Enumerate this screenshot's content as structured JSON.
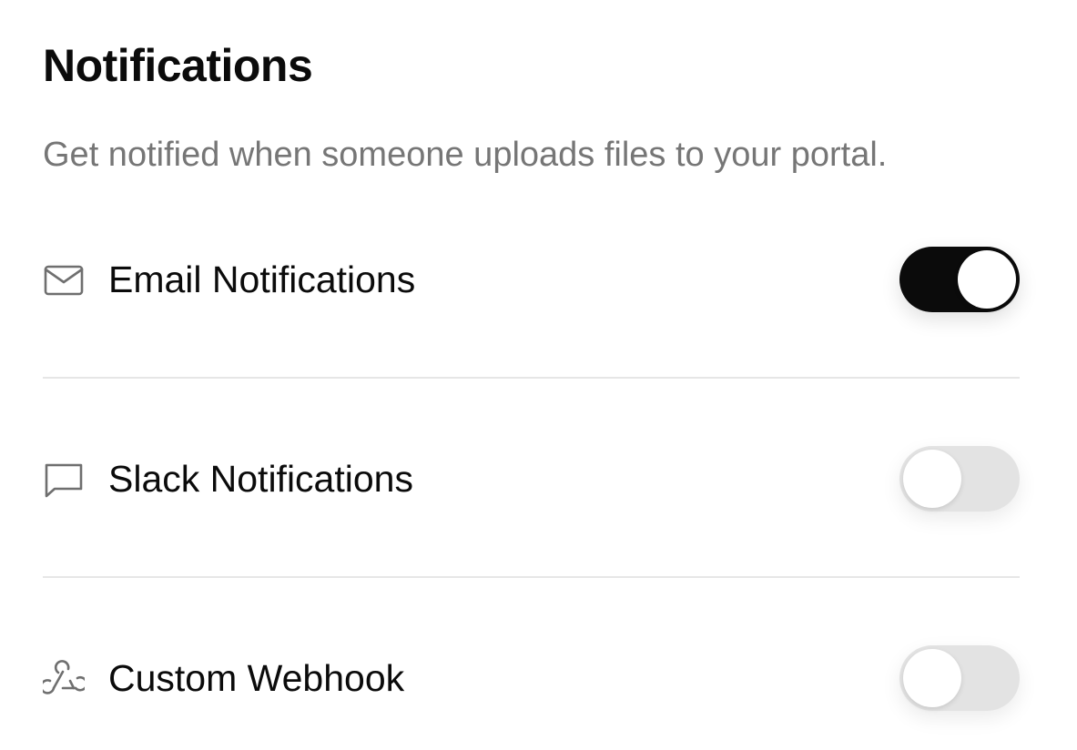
{
  "header": {
    "title": "Notifications",
    "subtitle": "Get notified when someone uploads files to your portal."
  },
  "settings": [
    {
      "icon": "mail-icon",
      "label": "Email Notifications",
      "enabled": true
    },
    {
      "icon": "chat-bubble-icon",
      "label": "Slack Notifications",
      "enabled": false
    },
    {
      "icon": "webhook-icon",
      "label": "Custom Webhook",
      "enabled": false
    }
  ],
  "colors": {
    "toggle_on": "#0b0b0b",
    "toggle_off": "#e3e3e3",
    "subtitle": "#767676",
    "icon": "#6f6f6f"
  }
}
